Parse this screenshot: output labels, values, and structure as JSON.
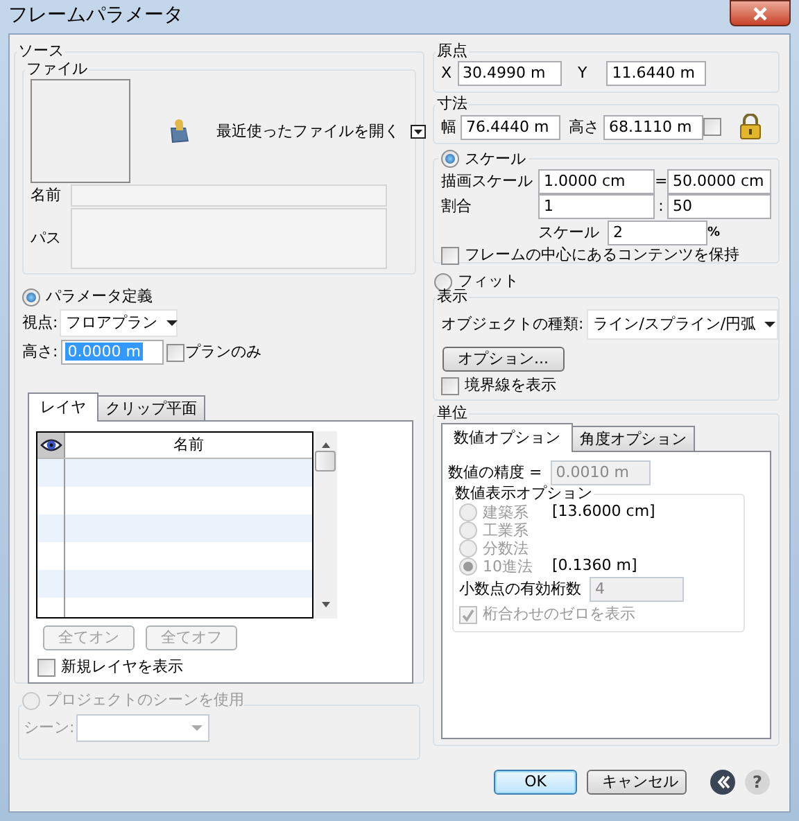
{
  "window": {
    "title": "フレームパラメータ"
  },
  "source": {
    "title": "ソース",
    "file": {
      "title": "ファイル",
      "recent": "最近使ったファイルを開く",
      "name_label": "名前",
      "path_label": "パス"
    },
    "param_mode": {
      "label": "パラメータ定義",
      "selected": true
    },
    "view_label": "視点:",
    "view": "フロアプラン",
    "height_label": "高さ:",
    "height": "0.0000 m",
    "plan_only": {
      "label": "プランのみ",
      "checked": false
    },
    "tabs": [
      {
        "label": "レイヤ",
        "selected": true
      },
      {
        "label": "クリップ平面",
        "selected": false
      }
    ],
    "layer_table": {
      "columns": [
        "名前"
      ]
    },
    "buttons": [
      {
        "label": "全てオン",
        "disabled": true
      },
      {
        "label": "全てオフ",
        "disabled": true
      }
    ],
    "show_new_layers": {
      "label": "新規レイヤを表示",
      "checked": false
    },
    "scene_mode": {
      "label": "プロジェクトのシーンを使用",
      "selected": false,
      "disabled": true
    },
    "scene_label": "シーン:"
  },
  "origin": {
    "title": "原点",
    "x_label": "X",
    "x": "30.4990 m",
    "y_label": "Y",
    "y": "11.6440 m"
  },
  "size": {
    "title": "寸法",
    "width_label": "幅",
    "width": "76.4440 m",
    "height_label": "高さ",
    "height": "68.1110 m",
    "lock_checked": false
  },
  "scale": {
    "mode": {
      "label": "スケール",
      "selected": true
    },
    "drawing_label": "描画スケール",
    "drawing": "1.0000 cm",
    "equals": "=",
    "real": "50.0000 cm",
    "ratio_label": "割合",
    "ratio_a": "1",
    "colon": ":",
    "ratio_b": "50",
    "scale_label": "スケール",
    "scale": "2",
    "percent": "%",
    "keep_center": {
      "label": "フレームの中心にあるコンテンツを保持",
      "checked": false
    }
  },
  "fit": {
    "label": "フィット",
    "selected": false
  },
  "display": {
    "title": "表示",
    "object_type_label": "オブジェクトの種類:",
    "object_type": "ライン/スプライン/円弧",
    "options_button": "オプション...",
    "show_border": {
      "label": "境界線を表示",
      "checked": false
    }
  },
  "units": {
    "title": "単位",
    "tabs": [
      {
        "label": "数値オプション",
        "selected": true
      },
      {
        "label": "角度オプション",
        "selected": false
      }
    ],
    "precision_label": "数値の精度 =",
    "precision": "0.0010 m",
    "format_title": "数値表示オプション",
    "formats": [
      {
        "label": "建築系",
        "selected": false,
        "disabled": true
      },
      {
        "label": "工業系",
        "selected": false,
        "disabled": true
      },
      {
        "label": "分数法",
        "selected": false,
        "disabled": true
      },
      {
        "label": "10進法",
        "selected": true,
        "disabled": true
      }
    ],
    "sample_1": "[13.6000 cm]",
    "sample_2": "[0.1360 m]",
    "decimals_label": "小数点の有効桁数",
    "decimals": "4",
    "show_zeros": {
      "label": "桁合わせのゼロを表示",
      "checked": true,
      "disabled": true
    }
  },
  "footer": {
    "ok": "OK",
    "cancel": "キャンセル",
    "help": "?"
  }
}
